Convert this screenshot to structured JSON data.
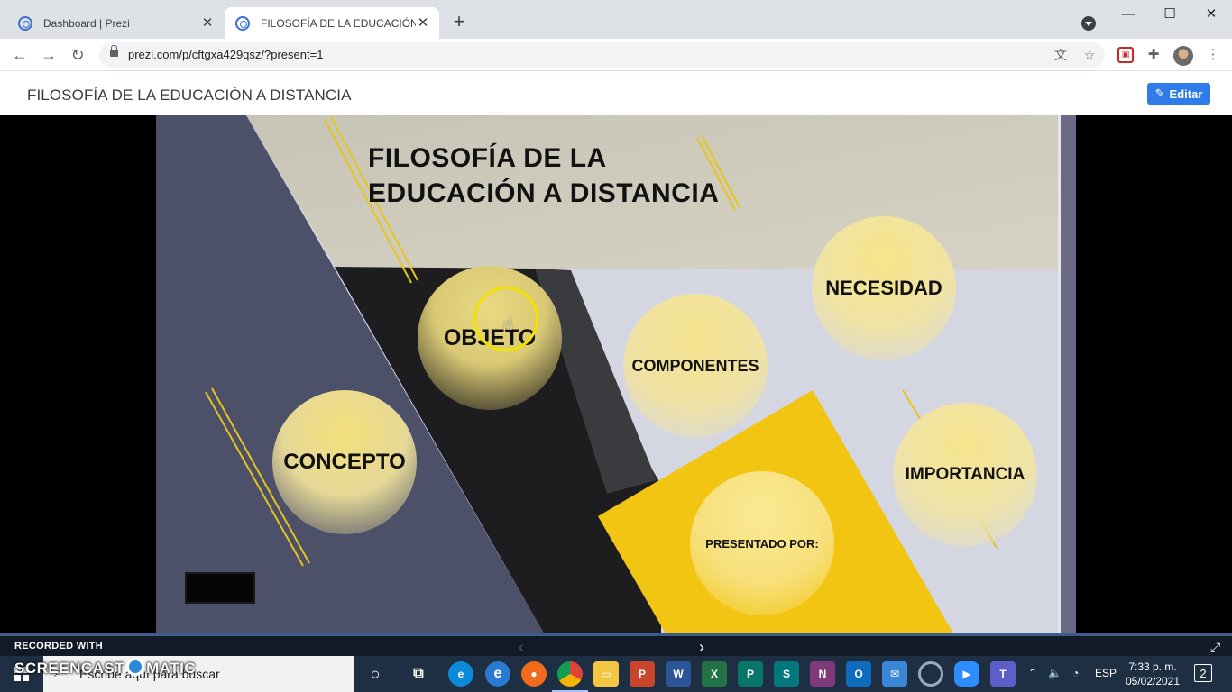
{
  "browser": {
    "tabs": [
      {
        "label": "Dashboard | Prezi",
        "active": false
      },
      {
        "label": "FILOSOFÍA DE LA EDUCACIÓN A",
        "active": true
      }
    ],
    "new_tab_symbol": "+",
    "url": "prezi.com/p/cftgxa429qsz/?present=1",
    "icons": [
      "back-icon",
      "forward-icon",
      "reload-icon",
      "lock-icon",
      "translate-icon",
      "star-icon",
      "extension-icon",
      "puzzle-icon",
      "profile-avatar",
      "more-icon"
    ]
  },
  "prezi": {
    "title": "FILOSOFÍA DE LA EDUCACIÓN A DISTANCIA",
    "edit_label": "Editar",
    "accent_color": "#2f7bea"
  },
  "slide": {
    "title_line1": "FILOSOFÍA DE LA",
    "title_line2": "EDUCACIÓN A DISTANCIA",
    "topics": {
      "objeto": "OBJETO",
      "componentes": "COMPONENTES",
      "necesidad": "NECESIDAD",
      "concepto": "CONCEPTO",
      "importancia": "IMPORTANCIA",
      "presentado": "PRESENTADO POR:"
    },
    "highlight_color": "#f2c512"
  },
  "recorder": {
    "label": "RECORDED WITH",
    "brand_left": "SCREENCAST",
    "brand_right": "MATIC"
  },
  "taskbar": {
    "search_placeholder": "Escribe aquí para buscar",
    "language": "ESP",
    "time": "7:33 p. m.",
    "date": "05/02/2021",
    "notifications": "2"
  }
}
